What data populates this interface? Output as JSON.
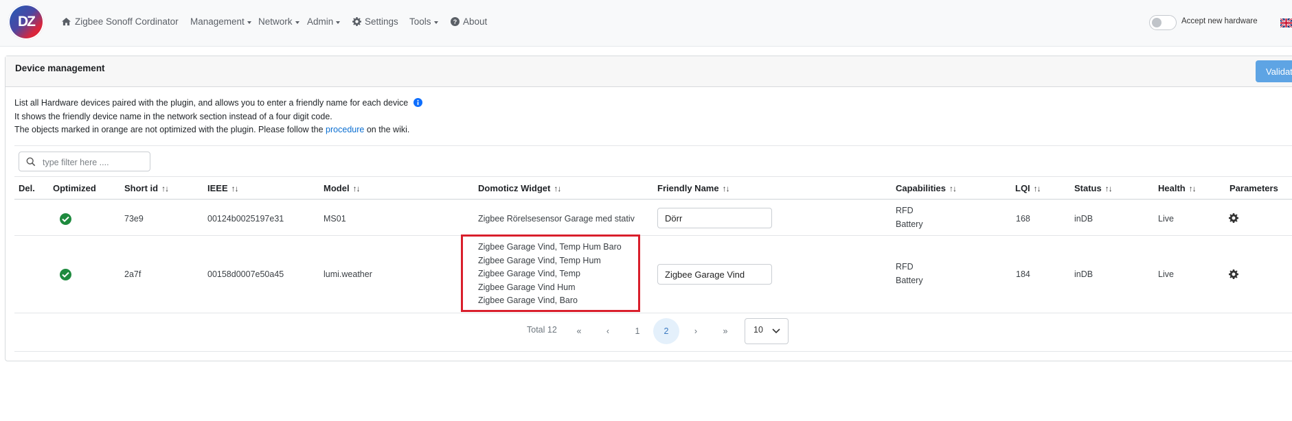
{
  "nav": {
    "logo_text": "DZ",
    "home": "Zigbee Sonoff Cordinator",
    "management": "Management",
    "network": "Network",
    "admin": "Admin",
    "settings": "Settings",
    "tools": "Tools",
    "about": "About",
    "accept_hw_label": "Accept new hardware",
    "accept_hw_enabled": false
  },
  "card": {
    "title": "Device management",
    "validate_label": "Validate",
    "desc_line1": "List all Hardware devices paired with the plugin, and allows you to enter a friendly name for each device",
    "desc_line2": "It shows the friendly device name in the network section instead of a four digit code.",
    "desc_line3_before": "The objects marked in orange are not optimized with the plugin. Please follow the ",
    "desc_line3_link": "procedure",
    "desc_line3_after": " on the wiki."
  },
  "filter": {
    "placeholder": "type filter here ...."
  },
  "table": {
    "sort_glyph": "↑↓",
    "headers": {
      "del": "Del.",
      "optimized": "Optimized",
      "short_id": "Short id",
      "ieee": "IEEE",
      "model": "Model",
      "widget": "Domoticz Widget",
      "friendly": "Friendly Name",
      "capabilities": "Capabilities",
      "lqi": "LQI",
      "status": "Status",
      "health": "Health",
      "parameters": "Parameters"
    },
    "rows": [
      {
        "optimized": true,
        "short_id": "73e9",
        "ieee": "00124b0025197e31",
        "model": "MS01",
        "widgets": [
          "Zigbee Rörelsesensor Garage med stativ"
        ],
        "friendly_name": "Dörr",
        "capabilities": [
          "RFD",
          "Battery"
        ],
        "lqi": "168",
        "status": "inDB",
        "health": "Live"
      },
      {
        "optimized": true,
        "short_id": "2a7f",
        "ieee": "00158d0007e50a45",
        "model": "lumi.weather",
        "widgets": [
          "Zigbee Garage Vind, Temp Hum Baro",
          "Zigbee Garage Vind, Temp Hum",
          "Zigbee Garage Vind, Temp",
          "Zigbee Garage Vind Hum",
          "Zigbee Garage Vind, Baro"
        ],
        "friendly_name": "Zigbee Garage Vind",
        "capabilities": [
          "RFD",
          "Battery"
        ],
        "lqi": "184",
        "status": "inDB",
        "health": "Live"
      }
    ]
  },
  "pagination": {
    "total_label": "Total 12",
    "first": "«",
    "prev": "‹",
    "pages": [
      "1",
      "2"
    ],
    "current_page": "2",
    "next": "›",
    "last": "»",
    "page_size": "10"
  },
  "colors": {
    "accent": "#5ea4e4",
    "highlight_box": "#d91e2b",
    "check_green": "#1e8a3e",
    "link": "#0a6ed1"
  }
}
